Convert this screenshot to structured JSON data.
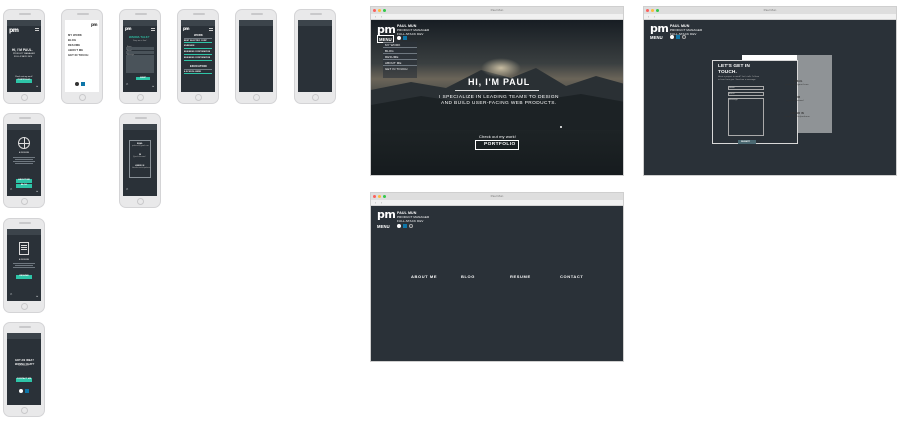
{
  "phones": {
    "p1": {
      "greeting": "HI, I'M PAUL.",
      "tagline1": "PRODUCT MANAGER",
      "tagline2": "FULL-STACK DEV",
      "cta_text": "Check out my work!",
      "button": "PORTFOLIO"
    },
    "p2": {
      "menu": [
        "MY WORK",
        "BLOG",
        "RESUME",
        "ABOUT ME",
        "GET IN TOUCH"
      ]
    },
    "p3": {
      "title": "WANNA TALK?",
      "subtitle": "Drop me a line!",
      "fields": [
        "Name",
        "Email",
        "Message"
      ],
      "button": "SUBMIT"
    },
    "p4": {
      "work_heading": "WORK",
      "jobs": [
        "BEST ELECTRIC CORP",
        "ENRESIDE",
        "BUSINESS CORPORATION",
        "BUSINESS CORPORATION"
      ],
      "edu_heading": "EDUCATION",
      "school": "A SCHOOL HERE"
    },
    "p7": {
      "caption": "A RESUME",
      "buttons": [
        "ABOUT ME",
        "BLOG"
      ]
    },
    "p8": {
      "caption": "A RESUME",
      "button": "RESUME"
    },
    "p9": {
      "line1": "GOT AN IDEA?",
      "line2": "WANNA CHAT?",
      "sub": "Let's connect",
      "button": "CONTACT ME"
    },
    "p10": {
      "email_label": "EMAIL",
      "email": "paulmun9@gmail.com",
      "im_label": "IM",
      "im": "@paul.chrisawol",
      "li_label": "LINKED IN",
      "li": "linkedin.com/in/paulmun"
    }
  },
  "window1": {
    "title": "Paul Mun",
    "brand_name": "PAUL MUN",
    "brand_role1": "PRODUCT MANAGER",
    "brand_role2": "FULL-STACK DEV",
    "menu_label": "MENU",
    "menu_items": [
      "MY WORK",
      "BLOG",
      "RESUME",
      "ABOUT ME",
      "GET IN TOUCH"
    ],
    "headline": "HI, I'M PAUL",
    "subline1": "I SPECIALIZE IN LEADING TEAMS TO DESIGN",
    "subline2": "AND BUILD USER-FACING WEB PRODUCTS.",
    "cta_text": "Check out my work!",
    "button": "PORTFOLIO"
  },
  "window2": {
    "title": "Paul Mun",
    "brand_name": "PAUL MUN",
    "brand_role1": "PRODUCT MANAGER",
    "brand_role2": "FULL-STACK DEV",
    "menu_label": "MENU",
    "form_title1": "LET'S GET IN",
    "form_title2": "TOUCH.",
    "form_sub1": "Have a project in mind? Let's talk. I'd love",
    "form_sub2": "to hear from you. Send me a message.",
    "fields": [
      "Name",
      "Email",
      "Message"
    ],
    "submit": "SUBMIT",
    "email_label": "EMAIL",
    "email": "paulmun9@gmail.com",
    "im_label": "IM",
    "im": "@paul.chrisawol",
    "li_label": "LINKED IN",
    "li": "linkedin.com/in/paulmun"
  },
  "window3": {
    "title": "Paul Mun",
    "brand_name": "PAUL MUN",
    "brand_role1": "PRODUCT MANAGER",
    "brand_role2": "FULL-STACK DEV",
    "menu_label": "MENU",
    "nav": [
      "ABOUT ME",
      "BLOG",
      "RESUME",
      "CONTACT"
    ]
  },
  "colors": {
    "accent": "#2ec4a7",
    "dark": "#2a3138",
    "linkedin": "#0e76a8"
  }
}
